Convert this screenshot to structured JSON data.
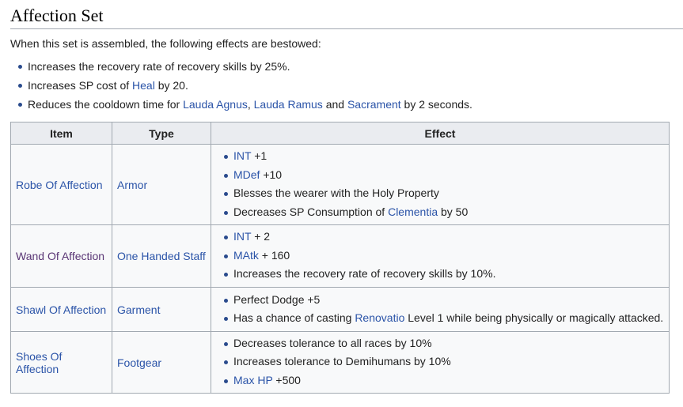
{
  "section": {
    "title": "Affection Set",
    "intro": "When this set is assembled, the following effects are bestowed:",
    "set_effects": [
      {
        "parts": [
          {
            "text": "Increases the recovery rate of recovery skills by 25%."
          }
        ]
      },
      {
        "parts": [
          {
            "text": "Increases SP cost of "
          },
          {
            "text": "Heal",
            "link": true
          },
          {
            "text": " by 20."
          }
        ]
      },
      {
        "parts": [
          {
            "text": "Reduces the cooldown time for "
          },
          {
            "text": "Lauda Agnus",
            "link": true
          },
          {
            "text": ", "
          },
          {
            "text": "Lauda Ramus",
            "link": true
          },
          {
            "text": " and "
          },
          {
            "text": "Sacrament",
            "link": true
          },
          {
            "text": " by 2 seconds."
          }
        ]
      }
    ]
  },
  "table": {
    "headers": [
      "Item",
      "Type",
      "Effect"
    ],
    "rows": [
      {
        "item": "Robe Of Affection",
        "item_visited": false,
        "type": "Armor",
        "effects": [
          {
            "parts": [
              {
                "text": "INT",
                "link": true
              },
              {
                "text": " +1"
              }
            ]
          },
          {
            "parts": [
              {
                "text": "MDef",
                "link": true
              },
              {
                "text": " +10"
              }
            ]
          },
          {
            "parts": [
              {
                "text": "Blesses the wearer with the Holy Property"
              }
            ]
          },
          {
            "parts": [
              {
                "text": "Decreases SP Consumption of "
              },
              {
                "text": "Clementia",
                "link": true
              },
              {
                "text": " by 50"
              }
            ]
          }
        ]
      },
      {
        "item": "Wand Of Affection",
        "item_visited": true,
        "type": "One Handed Staff",
        "effects": [
          {
            "parts": [
              {
                "text": "INT",
                "link": true
              },
              {
                "text": " + 2"
              }
            ]
          },
          {
            "parts": [
              {
                "text": "MAtk",
                "link": true
              },
              {
                "text": " + 160"
              }
            ]
          },
          {
            "parts": [
              {
                "text": "Increases the recovery rate of recovery skills by 10%."
              }
            ]
          }
        ]
      },
      {
        "item": "Shawl Of Affection",
        "item_visited": false,
        "type": "Garment",
        "effects": [
          {
            "parts": [
              {
                "text": "Perfect Dodge +5"
              }
            ]
          },
          {
            "parts": [
              {
                "text": "Has a chance of casting "
              },
              {
                "text": "Renovatio",
                "link": true
              },
              {
                "text": " Level 1 while being physically or magically attacked."
              }
            ]
          }
        ]
      },
      {
        "item": "Shoes Of Affection",
        "item_visited": false,
        "type": "Footgear",
        "effects": [
          {
            "parts": [
              {
                "text": "Decreases tolerance to all races by 10%"
              }
            ]
          },
          {
            "parts": [
              {
                "text": "Increases tolerance to Demihumans by 10%"
              }
            ]
          },
          {
            "parts": [
              {
                "text": "Max HP",
                "link": true
              },
              {
                "text": " +500"
              }
            ]
          }
        ]
      }
    ]
  },
  "colors": {
    "link": "#2b54a8",
    "visited_link": "#5a3675",
    "header_bg": "#eaecf0",
    "table_bg": "#f8f9fa",
    "border": "#a2a9b1",
    "text": "#222222"
  }
}
